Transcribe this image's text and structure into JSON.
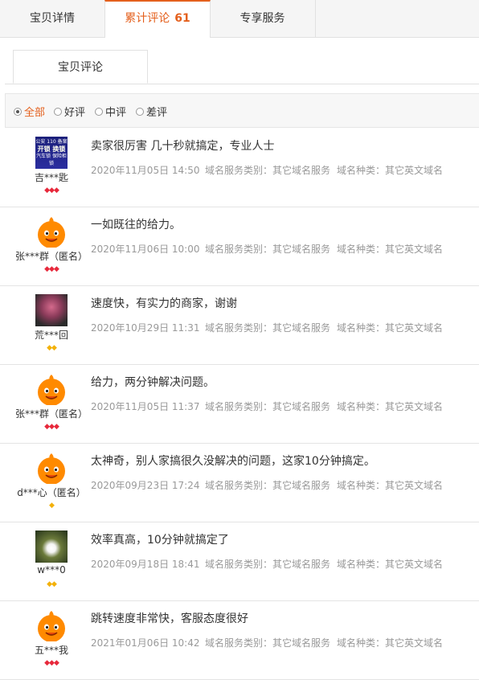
{
  "tabs": {
    "details": "宝贝详情",
    "reviews": "累计评论",
    "reviews_count": "61",
    "service": "专享服务"
  },
  "subtab": {
    "label": "宝贝评论"
  },
  "filter": {
    "all": "全部",
    "good": "好评",
    "neutral": "中评",
    "bad": "差评",
    "selected": "all"
  },
  "reviews": [
    {
      "user": "吉***匙",
      "text": "卖家很厉害 几十秒就搞定，专业人士",
      "date": "2020年11月05日 14:50",
      "service_type": "域名服务类别：其它域名服务",
      "domain_type": "域名种类：其它英文域名",
      "avatar": "dark-badge",
      "level_icon": "red-diamond",
      "level_count": 3,
      "avatar_text": [
        "公安 110 备案",
        "开锁",
        "换锁",
        "汽车锁 保险柜锁"
      ]
    },
    {
      "user": "张***群（匿名）",
      "text": "一如既往的给力。",
      "date": "2020年11月06日 10:00",
      "service_type": "域名服务类别：其它域名服务",
      "domain_type": "域名种类：其它英文域名",
      "avatar": "taobao-mascot",
      "level_icon": "red-diamond",
      "level_count": 3
    },
    {
      "user": "荒***回",
      "text": "速度快，有实力的商家，谢谢",
      "date": "2020年10月29日 11:31",
      "service_type": "域名服务类别：其它域名服务",
      "domain_type": "域名种类：其它英文域名",
      "avatar": "photo",
      "level_icon": "gold-diamond",
      "level_count": 2
    },
    {
      "user": "张***群（匿名）",
      "text": "给力，两分钟解决问题。",
      "date": "2020年11月05日 11:37",
      "service_type": "域名服务类别：其它域名服务",
      "domain_type": "域名种类：其它英文域名",
      "avatar": "taobao-mascot",
      "level_icon": "red-diamond",
      "level_count": 3
    },
    {
      "user": "d***心（匿名）",
      "text": "太神奇，别人家搞很久没解决的问题，这家10分钟搞定。",
      "date": "2020年09月23日 17:24",
      "service_type": "域名服务类别：其它域名服务",
      "domain_type": "域名种类：其它英文域名",
      "avatar": "taobao-mascot",
      "level_icon": "gold-diamond",
      "level_count": 1
    },
    {
      "user": "w***0",
      "text": "效率真高，10分钟就搞定了",
      "date": "2020年09月18日 18:41",
      "service_type": "域名服务类别：其它域名服务",
      "domain_type": "域名种类：其它英文域名",
      "avatar": "flower",
      "level_icon": "gold-diamond",
      "level_count": 2
    },
    {
      "user": "五***我",
      "text": "跳转速度非常快，客服态度很好",
      "date": "2021年01月06日 10:42",
      "service_type": "域名服务类别：其它域名服务",
      "domain_type": "域名种类：其它英文域名",
      "avatar": "taobao-mascot",
      "level_icon": "red-diamond",
      "level_count": 3
    }
  ]
}
